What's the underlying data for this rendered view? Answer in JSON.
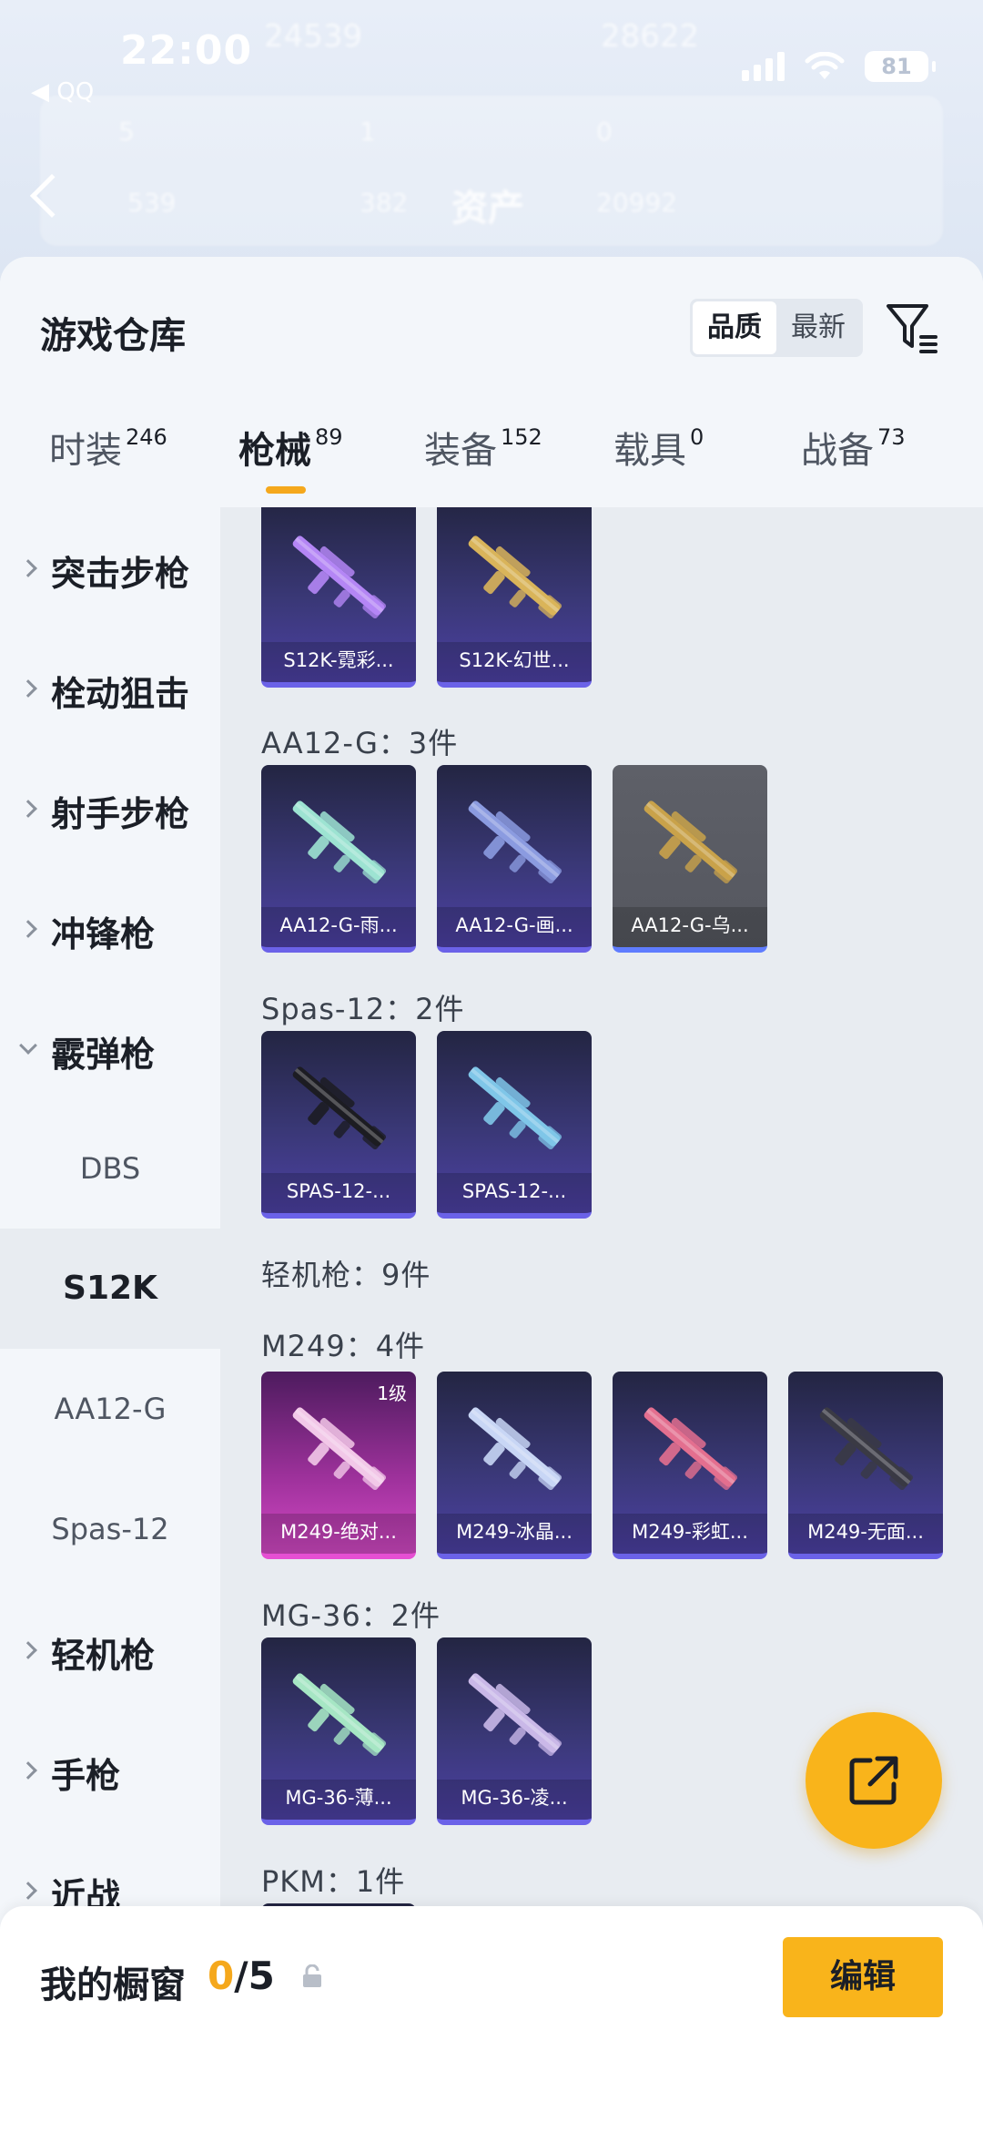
{
  "status_bar": {
    "time": "22:00",
    "back_app": "◀ QQ",
    "battery": "81"
  },
  "backdrop": {
    "title": "资产",
    "ghost_values": [
      "24539",
      "28622",
      "5",
      "1",
      "0",
      "539",
      "382",
      "20992"
    ]
  },
  "header": {
    "title": "游戏仓库",
    "sort_options": [
      {
        "label": "品质",
        "active": true
      },
      {
        "label": "最新",
        "active": false
      }
    ]
  },
  "tabs": [
    {
      "label": "时装",
      "count": "246",
      "active": false
    },
    {
      "label": "枪械",
      "count": "89",
      "active": true
    },
    {
      "label": "装备",
      "count": "152",
      "active": false
    },
    {
      "label": "载具",
      "count": "0",
      "active": false
    },
    {
      "label": "战备",
      "count": "73",
      "active": false
    }
  ],
  "sidebar": {
    "categories": [
      {
        "label": "突击步枪",
        "expanded": false
      },
      {
        "label": "栓动狙击",
        "expanded": false
      },
      {
        "label": "射手步枪",
        "expanded": false
      },
      {
        "label": "冲锋枪",
        "expanded": false
      },
      {
        "label": "霰弹枪",
        "expanded": true
      },
      {
        "label": "轻机枪",
        "expanded": false
      },
      {
        "label": "手枪",
        "expanded": false
      },
      {
        "label": "近战",
        "expanded": false
      }
    ],
    "subitems": [
      {
        "label": "DBS",
        "active": false
      },
      {
        "label": "S12K",
        "active": true
      },
      {
        "label": "AA12-G",
        "active": false
      },
      {
        "label": "Spas-12",
        "active": false
      }
    ]
  },
  "content": {
    "groups": [
      {
        "label": "AA12-G：3件"
      },
      {
        "label": "Spas-12：2件"
      },
      {
        "label": "轻机枪：9件"
      },
      {
        "label": "M249：4件"
      },
      {
        "label": "MG-36：2件"
      },
      {
        "label": "PKM：1件"
      }
    ],
    "cards": [
      {
        "name": "S12K-霓彩...",
        "style": "purple",
        "gun_color": "#b486f5"
      },
      {
        "name": "S12K-幻世...",
        "style": "purple",
        "gun_color": "#d9b45a"
      },
      {
        "name": "AA12-G-雨...",
        "style": "purple",
        "gun_color": "#9de3d2"
      },
      {
        "name": "AA12-G-画...",
        "style": "purple",
        "gun_color": "#8b9be0"
      },
      {
        "name": "AA12-G-乌...",
        "style": "grey",
        "gun_color": "#c9a24a"
      },
      {
        "name": "SPAS-12-...",
        "style": "purple",
        "gun_color": "#1c1c22"
      },
      {
        "name": "SPAS-12-...",
        "style": "purple",
        "gun_color": "#7fc6e8"
      },
      {
        "name": "M249-绝对...",
        "style": "pink",
        "gun_color": "#f2c8e8",
        "badge": "1级"
      },
      {
        "name": "M249-冰晶...",
        "style": "purple",
        "gun_color": "#c8d6f5"
      },
      {
        "name": "M249-彩虹...",
        "style": "purple",
        "gun_color": "#e36f8f"
      },
      {
        "name": "M249-无面...",
        "style": "purple",
        "gun_color": "#3a3a44"
      },
      {
        "name": "MG-36-薄...",
        "style": "purple",
        "gun_color": "#a6e6c4"
      },
      {
        "name": "MG-36-凌...",
        "style": "purple",
        "gun_color": "#c9b8e8"
      }
    ]
  },
  "bottom": {
    "label": "我的橱窗",
    "count_current": "0",
    "count_total": "/5",
    "edit_label": "编辑"
  },
  "colors": {
    "accent": "#f9b41b",
    "card_purple": "#3a3877",
    "card_pink": "#a0329d",
    "card_grey": "#5e6068"
  },
  "icons": {
    "filter": "filter-list-icon",
    "share": "share-external-icon",
    "lock": "lock-icon",
    "chevron": "chevron-right-icon"
  }
}
